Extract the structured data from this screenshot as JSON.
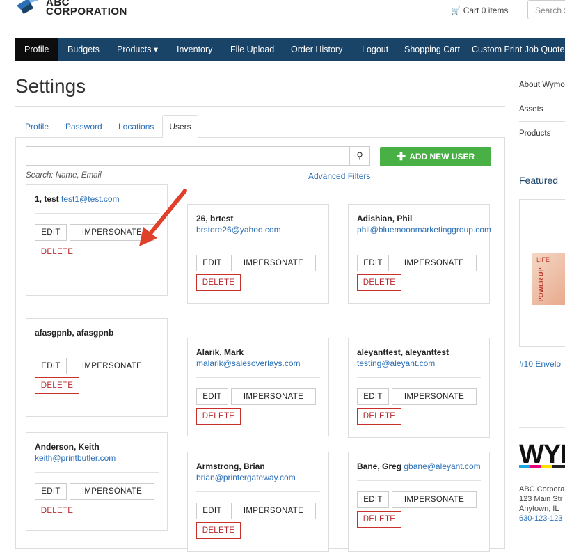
{
  "header": {
    "logo_line1": "ABC",
    "logo_line2": "CORPORATION",
    "cart_label": "Cart 0 items",
    "search_placeholder": "Search S"
  },
  "nav": {
    "items": [
      "Profile",
      "Budgets",
      "Products ▾",
      "Inventory",
      "File Upload",
      "Order History",
      "Logout",
      "Shopping Cart",
      "Custom Print Job Quote"
    ]
  },
  "settings": {
    "title": "Settings",
    "tabs": [
      "Profile",
      "Password",
      "Locations",
      "Users"
    ],
    "search_hint": "Search: Name, Email",
    "advanced_filters": "Advanced Filters",
    "add_user": "ADD NEW USER",
    "buttons": {
      "edit": "EDIT",
      "impersonate": "IMPERSONATE",
      "delete": "DELETE"
    }
  },
  "users": [
    {
      "name": "1, test",
      "email": "test1@test.com",
      "inline": true
    },
    {
      "name": "26, brtest",
      "email": "brstore26@yahoo.com",
      "inline": false
    },
    {
      "name": "Adishian, Phil",
      "email": "phil@bluemoonmarketinggroup.com",
      "inline": false
    },
    {
      "name": "afasgpnb, afasgpnb",
      "email": "",
      "inline": true
    },
    {
      "name": "Alarik, Mark",
      "email": "malarik@salesoverlays.com",
      "inline": false
    },
    {
      "name": "aleyanttest, aleyanttest",
      "email": "testing@aleyant.com",
      "inline": false
    },
    {
      "name": "Anderson, Keith",
      "email": "keith@printbutler.com",
      "inline": false
    },
    {
      "name": "Armstrong, Brian",
      "email": "brian@printergateway.com",
      "inline": false
    },
    {
      "name": "Bane, Greg",
      "email": "gbane@aleyant.com",
      "inline": true
    }
  ],
  "sidebar": {
    "links": [
      "About Wymo",
      "Assets",
      "Products"
    ],
    "featured_title": "Featured",
    "featured_link": "#10 Envelo",
    "product_text": "LIFE",
    "product_side": "POWER UP",
    "brand": "WYI",
    "address": [
      "ABC Corpora",
      "123 Main Str",
      "Anytown, IL",
      "630-123-123"
    ]
  },
  "colors": {
    "nav_bg": "#1a4368",
    "nav_active": "#0d0d0d",
    "add_button": "#49b045",
    "link": "#2a6fb6",
    "delete": "#b7282e"
  }
}
